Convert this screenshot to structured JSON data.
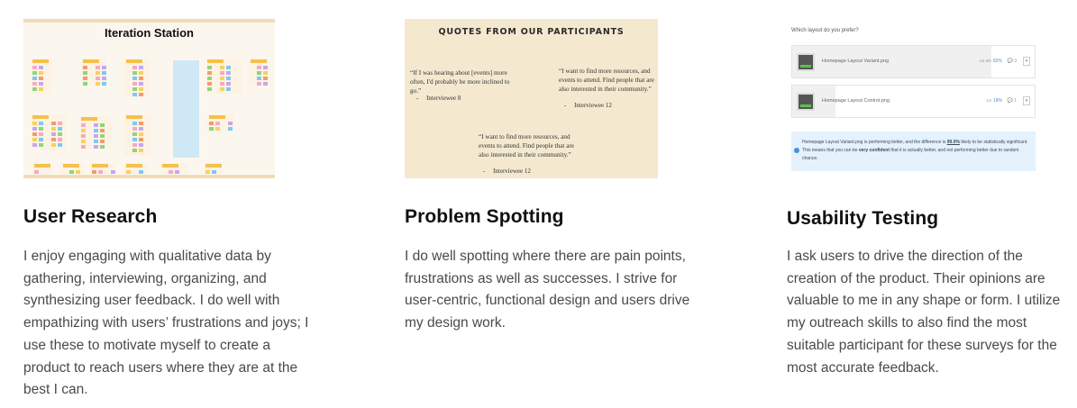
{
  "cards": [
    {
      "title": "User Research",
      "description": "I enjoy engaging with qualitative data by gathering, interviewing, organizing, and synthesizing user feedback. I do well with empathizing with users’ frustrations and joys; I use these to motivate myself to create a product to reach users where they are at the best I can.",
      "thumbnail": {
        "board_title": "Iteration Station"
      }
    },
    {
      "title": "Problem Spotting",
      "description": "I do well spotting where there are pain points, frustrations as well as successes. I strive for user-centric, functional design and users drive my design work.",
      "thumbnail": {
        "heading": "QUOTES FROM OUR PARTICIPANTS",
        "quotes": [
          {
            "text": "“If I was hearing about [events] more often, I'd probably be more inclined to go.”",
            "attribution": "Interviewee 8"
          },
          {
            "text": "“I want to find more resources, and events to attend. Find people that are also interested in their community.”",
            "attribution": "Interviewee 12"
          },
          {
            "text": "“I want to find more resources, and events to attend. Find people that are also interested in their community.”",
            "attribution": "Interviewee 12"
          }
        ]
      }
    },
    {
      "title": "Usability Testing",
      "description": "I ask users to drive the direction of the creation of the product. Their opinions are valuable to me in any shape or form. I utilize my outreach skills to also find the most suitable participant for these surveys for the most accurate feedback.",
      "thumbnail": {
        "question": "Which layout do you prefer?",
        "options": [
          {
            "name": "Homepage Layout Variant.png",
            "votes": "1st 5th",
            "percent": "82%",
            "share": 0.82,
            "comments": "3"
          },
          {
            "name": "Homepage Layout Control.png",
            "votes": "1st",
            "percent": "18%",
            "share": 0.18,
            "comments": "1"
          }
        ],
        "result_text_1": "Homepage Layout Variant.png is performing better, and the difference is ",
        "result_highlight": "99.0%",
        "result_text_2": " likely to be statistically significant. This means that you can be ",
        "result_strong": "very confident",
        "result_text_3": " that it is actually better, and not performing better due to random chance."
      }
    }
  ],
  "colors": {
    "board_bg": "#fbf7ef",
    "quotes_bg": "#f4e9cf",
    "result_bg": "#e5f1fb",
    "accent_blue": "#4a90d9"
  }
}
